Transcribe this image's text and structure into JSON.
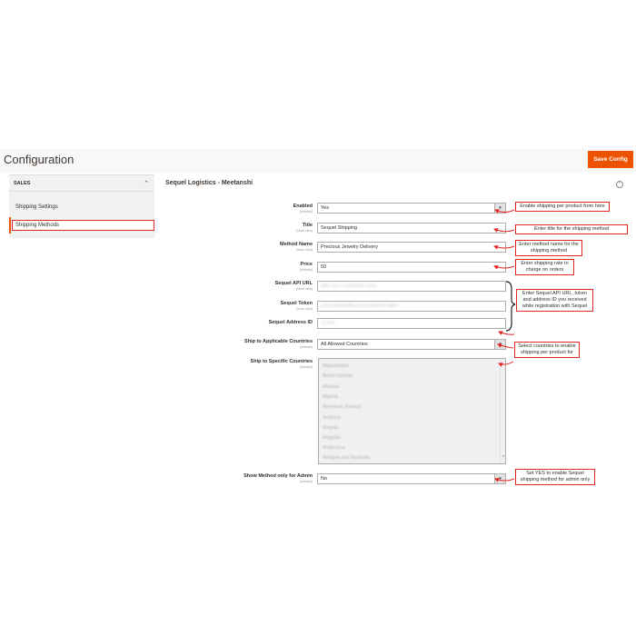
{
  "page": {
    "title": "Configuration",
    "save_label": "Save Config"
  },
  "sidebar": {
    "section": "SALES",
    "items": [
      {
        "label": "Shipping Settings"
      },
      {
        "label": "Shipping Methods"
      }
    ]
  },
  "section": {
    "title": "Sequel Logistics - Meetanshi"
  },
  "fields": {
    "enabled": {
      "label": "Enabled",
      "scope": "[website]",
      "value": "Yes"
    },
    "title": {
      "label": "Title",
      "scope": "[store view]",
      "value": "Sequel Shipping"
    },
    "method_name": {
      "label": "Method Name",
      "scope": "[store view]",
      "value": "Precious Jewelry Delivery"
    },
    "price": {
      "label": "Price",
      "scope": "[website]",
      "value": "50"
    },
    "api_url": {
      "label": "Sequel API URL",
      "scope": "[store view]",
      "value": "http://sec.sequel247.com"
    },
    "token": {
      "label": "Sequel Token",
      "scope": "[store view]",
      "value": "a1b2c3d4e5f6a1b2c3d4e5f67a8b9"
    },
    "address_id": {
      "label": "Sequel Address ID",
      "scope": "",
      "value": "12345"
    },
    "applicable": {
      "label": "Ship to Applicable Countries",
      "scope": "[website]",
      "value": "All Allowed Countries"
    },
    "specific": {
      "label": "Ship to Specific Countries",
      "scope": "[website]",
      "options": [
        "Afghanistan",
        "Åland Islands",
        "Albania",
        "Algeria",
        "American Samoa",
        "Andorra",
        "Angola",
        "Anguilla",
        "Antarctica",
        "Antigua and Barbuda"
      ]
    },
    "admin_only": {
      "label": "Show Method only for Admin",
      "scope": "[website]",
      "value": "No"
    }
  },
  "callouts": {
    "enabled": "Enable shipping per product from here",
    "title": "Enter title for the shipping method",
    "method_name": "Enter method name for the shipping method",
    "price": "Enter shipping rate to charge on orders",
    "api": "Enter Sequel API URL, token and address ID you received while registration with Sequel",
    "countries": "Select countries to enable shipping per product for",
    "admin": "Set YES to enable Sequel shipping method for admin only"
  },
  "colors": {
    "accent": "#eb5202",
    "callout_border": "#e22626"
  },
  "icons": {
    "collapse": "collapse-icon",
    "chevron": "chevron-up-icon",
    "dropdown": "chevron-down-icon"
  }
}
